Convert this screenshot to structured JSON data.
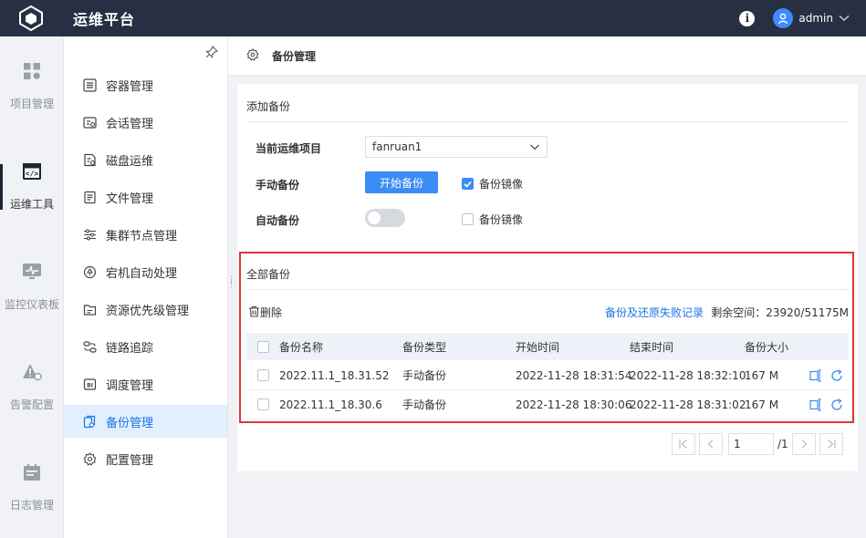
{
  "app": {
    "title": "运维平台",
    "user": "admin"
  },
  "rail": [
    {
      "label": "项目管理",
      "icon": "grid-icon",
      "active": false
    },
    {
      "label": "运维工具",
      "icon": "code-window-icon",
      "active": true
    },
    {
      "label": "监控仪表板",
      "icon": "monitor-pulse-icon",
      "active": false
    },
    {
      "label": "告警配置",
      "icon": "alert-gear-icon",
      "active": false
    },
    {
      "label": "日志管理",
      "icon": "calendar-log-icon",
      "active": false
    }
  ],
  "sidebar": {
    "items": [
      {
        "label": "容器管理",
        "icon": "container-icon"
      },
      {
        "label": "会话管理",
        "icon": "session-icon"
      },
      {
        "label": "磁盘运维",
        "icon": "disk-icon"
      },
      {
        "label": "文件管理",
        "icon": "file-icon"
      },
      {
        "label": "集群节点管理",
        "icon": "cluster-sliders-icon"
      },
      {
        "label": "宕机自动处理",
        "icon": "auto-recover-icon"
      },
      {
        "label": "资源优先级管理",
        "icon": "resource-priority-icon"
      },
      {
        "label": "链路追踪",
        "icon": "trace-link-icon"
      },
      {
        "label": "调度管理",
        "icon": "schedule-bi-icon"
      },
      {
        "label": "备份管理",
        "icon": "backup-icon",
        "active": true
      },
      {
        "label": "配置管理",
        "icon": "config-gear-icon"
      }
    ]
  },
  "header": {
    "title": "备份管理"
  },
  "add_backup": {
    "section_title": "添加备份",
    "project_label": "当前运维项目",
    "project_value": "fanruan1",
    "manual_label": "手动备份",
    "start_button": "开始备份",
    "manual_mirror_label": "备份镜像",
    "manual_mirror_checked": true,
    "auto_label": "自动备份",
    "auto_enabled": false,
    "auto_mirror_label": "备份镜像",
    "auto_mirror_checked": false
  },
  "all_backups": {
    "section_title": "全部备份",
    "delete_label": "删除",
    "fail_log_link": "备份及还原失败记录",
    "space_label": "剩余空间：23920/51175M",
    "columns": [
      "备份名称",
      "备份类型",
      "开始时间",
      "结束时间",
      "备份大小"
    ],
    "rows": [
      {
        "name": "2022.11.1_18.31.52",
        "type": "手动备份",
        "start": "2022-11-28 18:31:54",
        "end": "2022-11-28 18:32:10",
        "size": "167 M"
      },
      {
        "name": "2022.11.1_18.30.6",
        "type": "手动备份",
        "start": "2022-11-28 18:30:06",
        "end": "2022-11-28 18:31:02",
        "size": "167 M"
      }
    ]
  },
  "pagination": {
    "current": "1",
    "total": "/1"
  },
  "colors": {
    "topbar": "#263042",
    "accent": "#3b8cf5",
    "link": "#1b73e8",
    "highlight_border": "#d9383a",
    "active_bg": "#e3efff"
  }
}
